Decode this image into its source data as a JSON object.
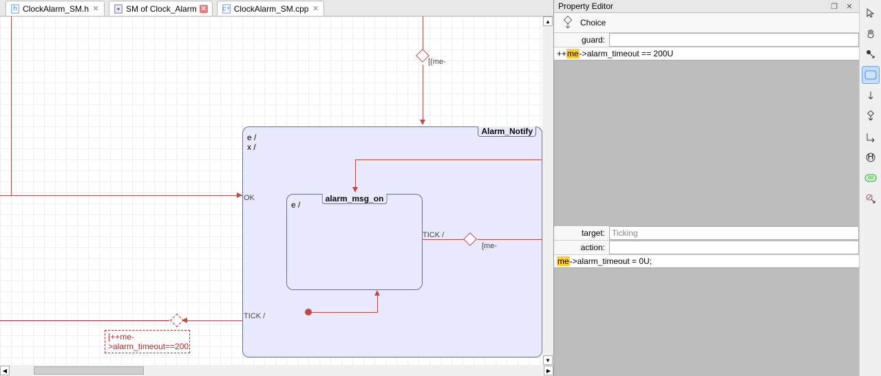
{
  "tabs": [
    {
      "label": "ClockAlarm_SM.h",
      "icon": "file-h"
    },
    {
      "label": "SM of Clock_Alarm",
      "icon": "file-sm"
    },
    {
      "label": "ClockAlarm_SM.cpp",
      "icon": "file-cpp"
    }
  ],
  "states": {
    "alarm_notify": {
      "title": "Alarm_Notify",
      "entry": "e /\nx /"
    },
    "alarm_msg_on": {
      "title": "alarm_msg_on",
      "entry": "e /"
    }
  },
  "transitions": {
    "ok": "OK",
    "tick1": "TICK /",
    "tick2": "TICK /",
    "guard_top": "[(me-",
    "guard_right": "[me-",
    "guard_sel_line1": "[++me-",
    "guard_sel_line2": ">alarm_timeout==200"
  },
  "property_editor": {
    "title": "Property Editor",
    "type": "Choice",
    "guard_label": "guard:",
    "guard_value": "",
    "guard_code_prefix": "++",
    "guard_code_hl": "me",
    "guard_code_suffix": "->alarm_timeout == 200U",
    "target_label": "target:",
    "target_value": "Ticking",
    "action_label": "action:",
    "action_value": "",
    "action_code_hl": "me",
    "action_code_suffix": "->alarm_timeout = 0U;"
  },
  "tools": [
    "select",
    "pan",
    "init",
    "state",
    "trans-down",
    "choice",
    "trans-corner",
    "history",
    "delete"
  ],
  "chart_data": {
    "type": "statechart",
    "selected_element": {
      "kind": "Choice",
      "guard": "++me->alarm_timeout == 200U",
      "target": "Ticking",
      "action": "me->alarm_timeout = 0U;"
    },
    "states": [
      {
        "name": "Alarm_Notify",
        "entry": "e /",
        "exit": "x /",
        "children": [
          "alarm_msg_on"
        ]
      },
      {
        "name": "alarm_msg_on",
        "entry": "e /"
      }
    ],
    "transitions": [
      {
        "from": "(outside-top)",
        "to": "Alarm_Notify",
        "via_choice": true,
        "guard": "(me-"
      },
      {
        "from": "(outside-left)",
        "to": "Alarm_Notify",
        "trigger": "OK"
      },
      {
        "from": "alarm_msg_on",
        "trigger": "TICK",
        "via_choice": true,
        "guard": "me-"
      },
      {
        "from": "Alarm_Notify",
        "trigger": "TICK",
        "via_choice": true,
        "guard": "++me->alarm_timeout==200U"
      },
      {
        "kind": "initial",
        "to": "alarm_msg_on"
      }
    ]
  }
}
